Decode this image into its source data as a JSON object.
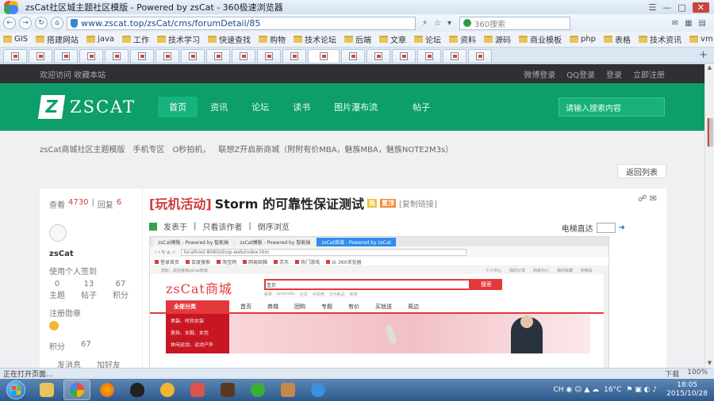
{
  "window": {
    "title": "zsCat社区城主题社区模版 - Powered by zsCat - 360极速浏览器"
  },
  "addressbar": {
    "url": "www.zscat.top/zsCat/cms/forumDetail/85",
    "search_placeholder": "360搜索",
    "back_label": "←",
    "forward_label": "→",
    "refresh_label": "↻",
    "home_label": "⌂"
  },
  "bookmarks": [
    "GIS",
    "搭建网站",
    "java",
    "工作",
    "技术学习",
    "快速查找",
    "购物",
    "技术论坛",
    "后端",
    "文章",
    "论坛",
    "资料",
    "源码",
    "商业模板",
    "php",
    "表格",
    "技术资讯",
    "vm"
  ],
  "tabs_count": 19,
  "site": {
    "topbar_left": "欢迎访问 收藏本站",
    "topbar_right": [
      "微博登录",
      "QQ登录",
      "登录",
      "立即注册"
    ],
    "brand_name": "ZSCAT",
    "brand_mark": "Z",
    "menu": [
      "首页",
      "资讯",
      "论坛",
      "读书",
      "图片瀑布流"
    ],
    "search_label": "帖子",
    "search_placeholder": "请输入搜索内容",
    "ticker": [
      "zsCat商城社区主题模版",
      "手机专区",
      "O秒拍机，",
      "联想Z开启新商城（附附有价MBA，魅族MBA，魅族NOTE2M3s）"
    ],
    "back_button": "返回列表"
  },
  "post": {
    "stats": {
      "views_label": "查看",
      "views": "4730",
      "replies_label": "回复",
      "replies": "6"
    },
    "author": "zsCat",
    "user_note": "使用个人签到",
    "user_grid": [
      {
        "value": "0",
        "label": "主题"
      },
      {
        "value": "13",
        "label": "帖子"
      },
      {
        "value": "67",
        "label": "积分"
      }
    ],
    "register_label": "注册勋章",
    "points_label": "积分",
    "points": "67",
    "send_msg": "发消息",
    "add_friend": "加好友",
    "category": "[玩机活动]",
    "title": "Storm 的可靠性保证测试",
    "tag1": "热",
    "tag2": "置顶",
    "small": "[复制链接]",
    "meta": [
      "发表于",
      "只看该作者",
      "倒序浏览"
    ],
    "jump_label": "电梯直达",
    "share": "☍ ✉"
  },
  "embedded": {
    "tabs": [
      "zsCat模版 - Powered by 智能插",
      "zsCat模版 - Powered by 智能插",
      "zsCat商城 - Powered by zsCat"
    ],
    "url": "localhost:8080/shop-web/index.htm",
    "bookmarks": [
      "登录首页",
      "百度搜索",
      "淘宝网",
      "网易邮箱",
      "京东",
      "热门游戏",
      "从 360浏览器"
    ],
    "topbar_left": "您好，欢迎来到zsCat商城",
    "topbar_right": [
      "个人中心",
      "我的订单",
      "商家中心",
      "我的收藏",
      "购物车"
    ],
    "logo": "zsCat商城",
    "search_select": "宝贝",
    "search_button": "搜索",
    "hot_words": [
      "荟萃",
      "iphone6s",
      "台式",
      "手机壳",
      "华为新品",
      "新款"
    ],
    "category_label": "全部分类",
    "nav": [
      "首页",
      "商城",
      "团购",
      "专题",
      "有价",
      "买就送",
      "周边"
    ],
    "side_items": [
      "男装、时尚女装",
      "美妆、女鞋、女包",
      "休闲运动、运动户外"
    ]
  },
  "statusbar": {
    "left": "正在打开页面...",
    "right": [
      "下载",
      "100%"
    ]
  },
  "taskbar": {
    "apps": [
      "explorer",
      "360browser",
      "firefox",
      "qq",
      "paint",
      "tool",
      "game",
      "wechat",
      "photo",
      "ie"
    ],
    "weather": "16°C",
    "time": "18:05",
    "date": "2015/10/28"
  }
}
